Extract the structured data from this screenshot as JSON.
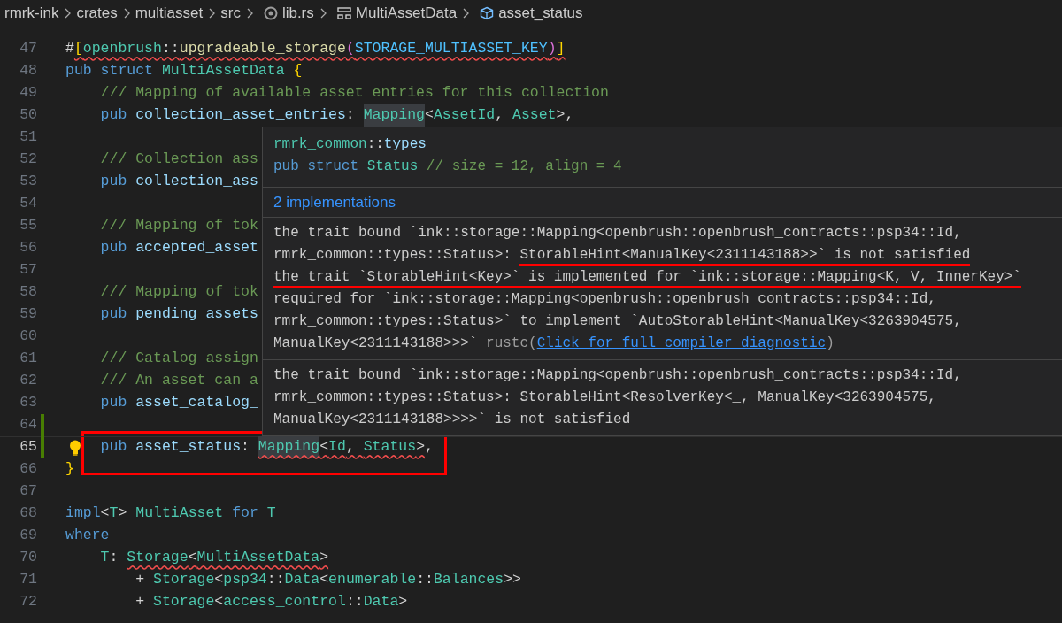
{
  "breadcrumb": [
    {
      "label": "rmrk-ink",
      "kind": "folder"
    },
    {
      "label": "crates",
      "kind": "folder"
    },
    {
      "label": "multiasset",
      "kind": "folder"
    },
    {
      "label": "src",
      "kind": "folder"
    },
    {
      "label": "lib.rs",
      "kind": "file"
    },
    {
      "label": "MultiAssetData",
      "kind": "struct"
    },
    {
      "label": "asset_status",
      "kind": "field"
    }
  ],
  "editor": {
    "lines": [
      {
        "number": "47",
        "tokens": [
          {
            "text": "#",
            "kind": "punct"
          },
          {
            "text": "[",
            "kind": "bracket",
            "error": true
          },
          {
            "text": "openbrush",
            "kind": "type",
            "error": true
          },
          {
            "text": "::",
            "kind": "punct",
            "error": true
          },
          {
            "text": "upgradeable_storage",
            "kind": "fn",
            "error": true
          },
          {
            "text": "(",
            "kind": "paren",
            "error": true
          },
          {
            "text": "STORAGE_MULTIASSET_KEY",
            "kind": "const",
            "error": true
          },
          {
            "text": ")",
            "kind": "paren",
            "error": true
          },
          {
            "text": "]",
            "kind": "bracket",
            "error": true
          }
        ]
      },
      {
        "number": "48",
        "tokens": [
          {
            "text": "pub struct ",
            "kind": "kw"
          },
          {
            "text": "MultiAssetData ",
            "kind": "type"
          },
          {
            "text": "{",
            "kind": "bracket"
          }
        ]
      },
      {
        "number": "49",
        "tokens": [
          {
            "text": "    /// Mapping of available asset entries for this collection",
            "kind": "comment"
          }
        ]
      },
      {
        "number": "50",
        "tokens": [
          {
            "text": "    pub",
            "kind": "kw"
          },
          {
            "text": " collection_asset_entries",
            "kind": "ident"
          },
          {
            "text": ": ",
            "kind": "punct"
          },
          {
            "text": "Mapping",
            "kind": "type",
            "highlight": true
          },
          {
            "text": "<",
            "kind": "punct"
          },
          {
            "text": "AssetId",
            "kind": "type"
          },
          {
            "text": ", ",
            "kind": "punct"
          },
          {
            "text": "Asset",
            "kind": "type"
          },
          {
            "text": ">,",
            "kind": "punct"
          }
        ]
      },
      {
        "number": "51"
      },
      {
        "number": "52",
        "tokens": [
          {
            "text": "    /// Collection ass",
            "kind": "comment"
          }
        ]
      },
      {
        "number": "53",
        "tokens": [
          {
            "text": "    pub",
            "kind": "kw"
          },
          {
            "text": " collection_ass",
            "kind": "ident"
          }
        ]
      },
      {
        "number": "54"
      },
      {
        "number": "55",
        "tokens": [
          {
            "text": "    /// Mapping of tok",
            "kind": "comment"
          }
        ]
      },
      {
        "number": "56",
        "tokens": [
          {
            "text": "    pub",
            "kind": "kw"
          },
          {
            "text": " accepted_asset",
            "kind": "ident"
          }
        ]
      },
      {
        "number": "57"
      },
      {
        "number": "58",
        "tokens": [
          {
            "text": "    /// Mapping of tok",
            "kind": "comment"
          }
        ]
      },
      {
        "number": "59",
        "tokens": [
          {
            "text": "    pub",
            "kind": "kw"
          },
          {
            "text": " pending_assets",
            "kind": "ident"
          }
        ]
      },
      {
        "number": "60"
      },
      {
        "number": "61",
        "tokens": [
          {
            "text": "    /// Catalog assign",
            "kind": "comment"
          }
        ]
      },
      {
        "number": "62",
        "tokens": [
          {
            "text": "    /// An asset can a",
            "kind": "comment"
          }
        ]
      },
      {
        "number": "63",
        "tokens": [
          {
            "text": "    pub",
            "kind": "kw"
          },
          {
            "text": " asset_catalog_",
            "kind": "ident"
          }
        ]
      },
      {
        "number": "64",
        "modified": true
      },
      {
        "number": "65",
        "modified": true,
        "current": true,
        "lightbulb": true,
        "tokens": [
          {
            "text": "    pub",
            "kind": "kw"
          },
          {
            "text": " asset_status",
            "kind": "ident"
          },
          {
            "text": ": ",
            "kind": "punct"
          },
          {
            "text": "Mapping",
            "kind": "type",
            "error": true,
            "highlight": true
          },
          {
            "text": "<",
            "kind": "punct",
            "error": true
          },
          {
            "text": "Id",
            "kind": "type",
            "error": true
          },
          {
            "text": ", ",
            "kind": "punct",
            "error": true
          },
          {
            "text": "Status",
            "kind": "link",
            "error": true
          },
          {
            "text": ">",
            "kind": "punct",
            "error": true
          },
          {
            "text": ",",
            "kind": "punct"
          }
        ]
      },
      {
        "number": "66",
        "tokens": [
          {
            "text": "}",
            "kind": "bracket"
          }
        ]
      },
      {
        "number": "67"
      },
      {
        "number": "68",
        "tokens": [
          {
            "text": "impl",
            "kind": "kw"
          },
          {
            "text": "<",
            "kind": "punct"
          },
          {
            "text": "T",
            "kind": "type"
          },
          {
            "text": "> ",
            "kind": "punct"
          },
          {
            "text": "MultiAsset",
            "kind": "type"
          },
          {
            "text": " for ",
            "kind": "kw"
          },
          {
            "text": "T",
            "kind": "type"
          }
        ]
      },
      {
        "number": "69",
        "tokens": [
          {
            "text": "where",
            "kind": "kw"
          }
        ]
      },
      {
        "number": "70",
        "tokens": [
          {
            "text": "    T",
            "kind": "type"
          },
          {
            "text": ": ",
            "kind": "punct"
          },
          {
            "text": "Storage",
            "kind": "type",
            "error": true
          },
          {
            "text": "<",
            "kind": "punct",
            "error": true
          },
          {
            "text": "MultiAssetData",
            "kind": "type",
            "error": true
          },
          {
            "text": ">",
            "kind": "punct",
            "error": true
          }
        ]
      },
      {
        "number": "71",
        "tokens": [
          {
            "text": "        + ",
            "kind": "punct"
          },
          {
            "text": "Storage",
            "kind": "type"
          },
          {
            "text": "<",
            "kind": "punct"
          },
          {
            "text": "psp34",
            "kind": "type"
          },
          {
            "text": "::",
            "kind": "punct"
          },
          {
            "text": "Data",
            "kind": "type"
          },
          {
            "text": "<",
            "kind": "punct"
          },
          {
            "text": "enumerable",
            "kind": "type"
          },
          {
            "text": "::",
            "kind": "punct"
          },
          {
            "text": "Balances",
            "kind": "type"
          },
          {
            "text": ">>",
            "kind": "punct"
          }
        ]
      },
      {
        "number": "72",
        "tokens": [
          {
            "text": "        + ",
            "kind": "punct"
          },
          {
            "text": "Storage",
            "kind": "type"
          },
          {
            "text": "<",
            "kind": "punct"
          },
          {
            "text": "access_control",
            "kind": "type"
          },
          {
            "text": "::",
            "kind": "punct"
          },
          {
            "text": "Data",
            "kind": "type"
          },
          {
            "text": ">",
            "kind": "punct"
          }
        ]
      }
    ]
  },
  "hover": {
    "signature": [
      [
        {
          "text": "rmrk_common",
          "kind": "type"
        },
        {
          "text": "::",
          "kind": "punct"
        },
        {
          "text": "types",
          "kind": "ident"
        }
      ],
      [
        {
          "text": "pub struct ",
          "kind": "kw"
        },
        {
          "text": "Status",
          "kind": "type"
        },
        {
          "text": " // size = 12, align = 4",
          "kind": "comment"
        }
      ]
    ],
    "implementations_link": "2 implementations",
    "diagnostics": [
      {
        "lines": [
          [
            {
              "text": "the trait bound `ink::storage::Mapping<openbrush::openbrush_contracts::psp34::Id,"
            }
          ],
          [
            {
              "text": "rmrk_common::types::Status>: "
            },
            {
              "text": "StorableHint<ManualKey<2311143188>>` is not satisfied",
              "marked": true
            }
          ],
          [
            {
              "text": "the trait `StorableHint<Key>` is implemented for `ink::storage::Mapping<K, V, InnerKey>`",
              "marked": true
            }
          ],
          [
            {
              "text": "required for `ink::storage::Mapping<openbrush::openbrush_contracts::psp34::Id,"
            }
          ],
          [
            {
              "text": "rmrk_common::types::Status>` to implement `AutoStorableHint<ManualKey<3263904575,"
            }
          ],
          [
            {
              "text": "ManualKey<2311143188>>>` "
            },
            {
              "text": "rustc",
              "kind": "muted"
            },
            {
              "text": "(",
              "kind": "muted"
            },
            {
              "text": "Click for full compiler diagnostic",
              "kind": "link"
            },
            {
              "text": ")",
              "kind": "muted"
            }
          ]
        ]
      },
      {
        "lines": [
          [
            {
              "text": "the trait bound `ink::storage::Mapping<openbrush::openbrush_contracts::psp34::Id,"
            }
          ],
          [
            {
              "text": "rmrk_common::types::Status>: StorableHint<ResolverKey<_, ManualKey<3263904575,"
            }
          ],
          [
            {
              "text": "ManualKey<2311143188>>>>` is not satisfied"
            }
          ]
        ]
      }
    ]
  }
}
